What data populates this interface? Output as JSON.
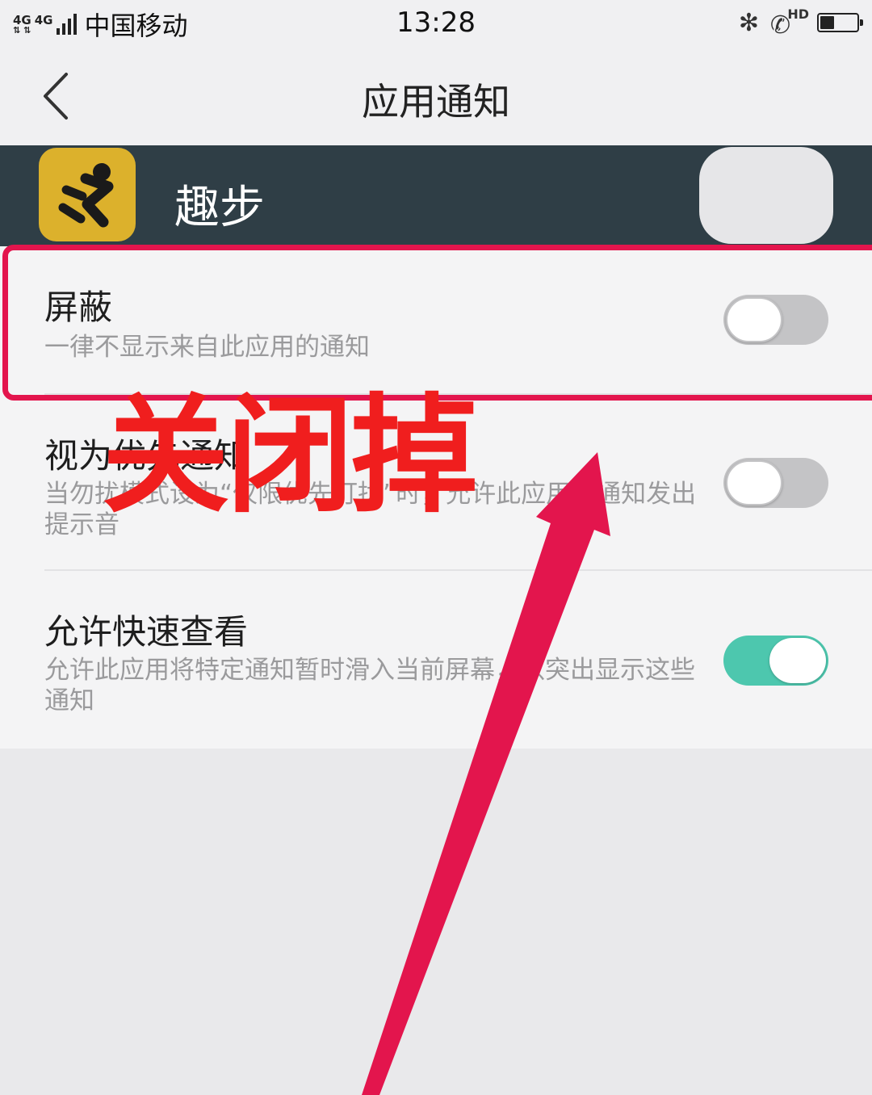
{
  "status_bar": {
    "network_badges": [
      "4G",
      "4G"
    ],
    "carrier": "中国移动",
    "time": "13:28",
    "hd_label": "HD",
    "battery_level": 0.4
  },
  "header": {
    "title": "应用通知"
  },
  "app": {
    "name": "趣步",
    "icon_color": "#dcb12c"
  },
  "settings": [
    {
      "title": "屏蔽",
      "description": "一律不显示来自此应用的通知",
      "enabled": false
    },
    {
      "title": "视为优先通知",
      "description": "当勿扰模式设为“仅限优先打扰”时，允许此应用的通知发出提示音",
      "enabled": false
    },
    {
      "title": "允许快速查看",
      "description": "允许此应用将特定通知暂时滑入当前屏幕，以突出显示这些通知",
      "enabled": true
    }
  ],
  "annotation": {
    "text": "关闭掉",
    "color": "#f01e1e",
    "arrow_color": "#e3154d"
  }
}
